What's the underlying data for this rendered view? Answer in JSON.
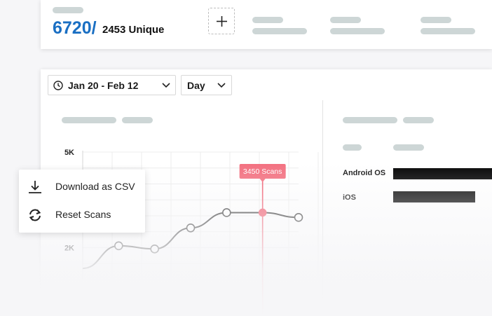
{
  "summary": {
    "total_scans": "6720/",
    "unique_label": "2453 Unique"
  },
  "filters": {
    "date_range": "Jan 20 - Feb 12",
    "interval": "Day"
  },
  "chart_data": {
    "type": "line",
    "y_tick_labels": [
      "5K",
      "2K"
    ],
    "ylim": [
      1000,
      5000
    ],
    "x": [
      0,
      1,
      2,
      3,
      4,
      5,
      6
    ],
    "series": [
      {
        "values": [
          1350,
          2060,
          1960,
          2620,
          3100,
          3100,
          2950
        ]
      }
    ],
    "highlight": {
      "x": 5,
      "label": "3450 Scans"
    },
    "grid": true
  },
  "colors": {
    "brand_blue": "#1a6fc3",
    "highlight_red": "#f0566a",
    "tooltip_bg": "#f36e7e"
  },
  "platforms": [
    {
      "label": "Android OS"
    },
    {
      "label": "iOS"
    }
  ],
  "context_menu": {
    "items": [
      {
        "label": "Download as CSV",
        "icon": "download-icon"
      },
      {
        "label": "Reset Scans",
        "icon": "refresh-icon"
      }
    ]
  }
}
